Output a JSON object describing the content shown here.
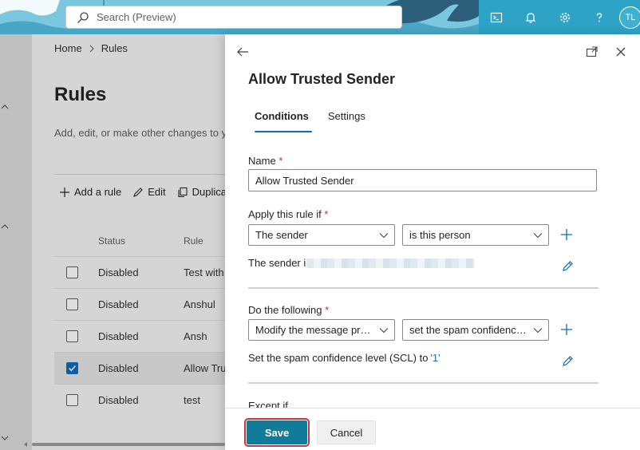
{
  "header": {
    "search_placeholder": "Search (Preview)",
    "avatar_initials": "TL",
    "icons": [
      "terminal-icon",
      "bell-icon",
      "gear-icon",
      "help-icon"
    ]
  },
  "page": {
    "breadcrumb": {
      "home": "Home",
      "current": "Rules"
    },
    "title": "Rules",
    "description": "Add, edit, or make other changes to yo",
    "commands": {
      "add": "Add a rule",
      "edit": "Edit",
      "duplicate": "Duplica"
    },
    "table": {
      "headers": {
        "status": "Status",
        "rule": "Rule"
      },
      "rows": [
        {
          "status": "Disabled",
          "rule": "Test with",
          "checked": false
        },
        {
          "status": "Disabled",
          "rule": "Anshul",
          "checked": false
        },
        {
          "status": "Disabled",
          "rule": "Ansh",
          "checked": false
        },
        {
          "status": "Disabled",
          "rule": "Allow Tru",
          "checked": true
        },
        {
          "status": "Disabled",
          "rule": "test",
          "checked": false
        }
      ]
    }
  },
  "panel": {
    "title": "Allow Trusted Sender",
    "tabs": {
      "conditions": "Conditions",
      "settings": "Settings"
    },
    "name_label": "Name",
    "required_mark": "*",
    "name_value": "Allow Trusted Sender",
    "apply_label": "Apply this rule if",
    "apply_field": "The sender",
    "apply_operator": "is this person",
    "apply_summary": "The sender i",
    "do_label": "Do the following",
    "do_field": "Modify the message pro...",
    "do_operator": "set the spam confidence ...",
    "do_summary_prefix": "Set the spam confidence level (SCL) to ",
    "do_summary_value": "'1'",
    "except_label": "Except if",
    "save_label": "Save",
    "cancel_label": "Cancel"
  },
  "colors": {
    "header_bg": "#7cc7e0",
    "header_icons_bg": "#2ea3c6",
    "accent": "#0f6cbd",
    "required": "#c4314b",
    "save_outline": "#d13438"
  }
}
